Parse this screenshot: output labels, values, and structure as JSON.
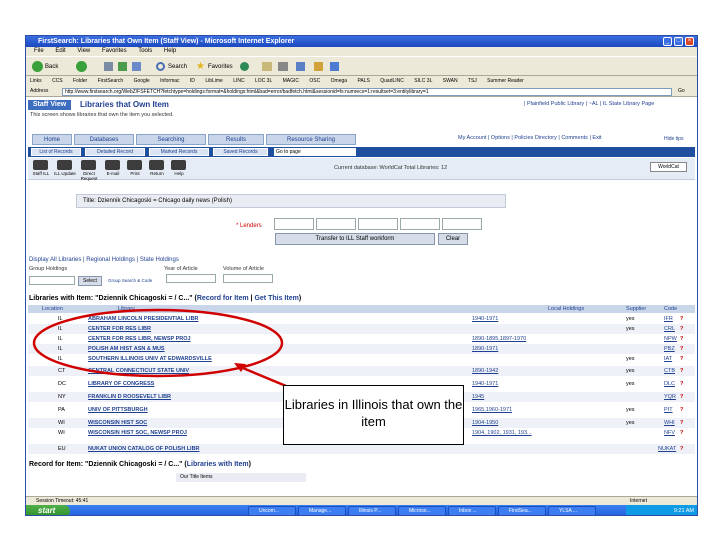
{
  "window": {
    "title": "FirstSearch: Libraries that Own Item (Staff View) - Microsoft Internet Explorer",
    "controls": [
      "_",
      "□",
      "×"
    ]
  },
  "menubar": [
    "File",
    "Edit",
    "View",
    "Favorites",
    "Tools",
    "Help"
  ],
  "toolbar": {
    "back_label": "Back",
    "search_label": "Search",
    "favorites_label": "Favorites"
  },
  "links_bar": [
    "Links",
    "CCS",
    "Folder",
    "FirstSearch",
    "Google",
    "Informac",
    "ID",
    "LibLime",
    "LINC",
    "LOC 3L",
    "MAGIC",
    "OSC",
    "Omega",
    "PALS",
    "QuadLINC",
    "SILC 3L",
    "SWAN",
    "TSJ",
    "Summer Reader"
  ],
  "address": {
    "label": "Address",
    "url": "http://www.firstsearch.org/WebZ/FSFETCH?fetchtype=holdings:format=&holdings:html&bad=error/badfetch.html&sessionid=fs:numrecs=1:resultset=3:entitylibrary=1",
    "go_label": "Go"
  },
  "page": {
    "staff_view_label": "Staff View",
    "title": "Libraries that Own Item",
    "top_links": "| Plainfield Public Library | ~AL | IL State Library Page",
    "screen_help": "This screen shows libraries that own the item you selected.",
    "tabs": [
      "Home",
      "Databases",
      "Searching",
      "Results",
      "Resource Sharing"
    ],
    "account_links": "My Account | Options | Policies Directory | Comments | Exit",
    "hide_tips": "Hide tips",
    "subnav": [
      "List of Records",
      "Detailed Record",
      "Marked Records",
      "Saved Records"
    ],
    "goto_page": "Go to page",
    "actions": [
      "Staff ILL",
      "ILL Update",
      "Direct Request",
      "E-mail",
      "Print",
      "Return",
      "Help"
    ],
    "db_info": "Current database: WorldCat  Total Libraries: 12",
    "worldcat_logo": "WorldCat",
    "title_line": "Title: Dziennik Chicagoski = Chicago daily news (Polish)",
    "lenders_label": "* Lenders",
    "transfer_button": "Transfer to ILL Staff workform",
    "clear_button": "Clear",
    "display_all": "Display All Libraries | Regional Holdings | State Holdings",
    "group_holdings": "Group Holdings",
    "year_label": "Year of Article",
    "volume_label": "Volume of Article",
    "select_button": "Select",
    "search_codes": "Group Search & Code",
    "libs_header": "Libraries with Item: \"Dziennik Chicagoski = / C...\" (",
    "record_for_item_link": "Record for Item",
    "get_item_link": "Get This Item",
    "libs_header_close": ")",
    "columns": [
      "Location",
      "Library",
      "Local Holdings",
      "Supplier",
      "Code"
    ],
    "rows": [
      {
        "loc": "IL",
        "lib": "ABRAHAM LINCOLN PRESIDENTIAL LIBR",
        "hold": "1940-1971",
        "sup": "yes",
        "code": "IFR"
      },
      {
        "loc": "IL",
        "lib": "CENTER FOR RES LIBR",
        "hold": "",
        "sup": "yes",
        "code": "CRL"
      },
      {
        "loc": "IL",
        "lib": "CENTER FOR RES LIBR, NEWSP PROJ",
        "hold": "1890-1895,1897-1970",
        "sup": "",
        "code": "NPW"
      },
      {
        "loc": "IL",
        "lib": "POLISH AM HIST ASN & MUS",
        "hold": "1890-1971",
        "sup": "",
        "code": "PBZ"
      },
      {
        "loc": "IL",
        "lib": "SOUTHERN ILLINOIS UNIV AT EDWARDSVILLE",
        "hold": "",
        "sup": "yes",
        "code": "IAT"
      },
      {
        "loc": "CT",
        "lib": "CENTRAL CONNECTICUT STATE UNIV",
        "hold": "1890-1942",
        "sup": "yes",
        "code": "CTB"
      },
      {
        "loc": "DC",
        "lib": "LIBRARY OF CONGRESS",
        "hold": "1940-1971",
        "sup": "yes",
        "code": "DLC"
      },
      {
        "loc": "NY",
        "lib": "FRANKLIN D ROOSEVELT LIBR",
        "hold": "1945",
        "sup": "",
        "code": "YQR"
      },
      {
        "loc": "PA",
        "lib": "UNIV OF PITTSBURGH",
        "hold": "1965,1960-1971",
        "sup": "yes",
        "code": "PIT"
      },
      {
        "loc": "WI",
        "lib": "WISCONSIN HIST SOC",
        "hold": "1904-1950",
        "sup": "yes",
        "code": "WHI"
      },
      {
        "loc": "WI",
        "lib": "WISCONSIN HIST SOC, NEWSP PROJ",
        "hold": "1904, 1902, 1931, 193...",
        "sup": "",
        "code": "NFV"
      },
      {
        "loc": "EU",
        "lib": "NUKAT UNION CATALOG OF POLISH LIBR",
        "hold": "",
        "sup": "",
        "code": "NUKAT"
      }
    ],
    "record_for": "Record for Item: \"Dziennik Chicagoski = / C...\" (",
    "libraries_with_item_link": "Libraries with Item",
    "record_for_close": ")",
    "our_title": "Our Title Items"
  },
  "statusbar": {
    "text": "Session Timeout: 45:41",
    "zone": "Internet"
  },
  "taskbar": {
    "start": "start",
    "tasks": [
      "Uncom...",
      "Manage...",
      "Illinois P...",
      "Microso...",
      "Inbox ...",
      "FirstSea...",
      "YLSA ..."
    ],
    "clock": "9:21 AM"
  },
  "annotation": {
    "callout": "Libraries in Illinois that own the item"
  },
  "colors": {
    "accent": "#1f3f8f",
    "annotation": "#d00000"
  }
}
